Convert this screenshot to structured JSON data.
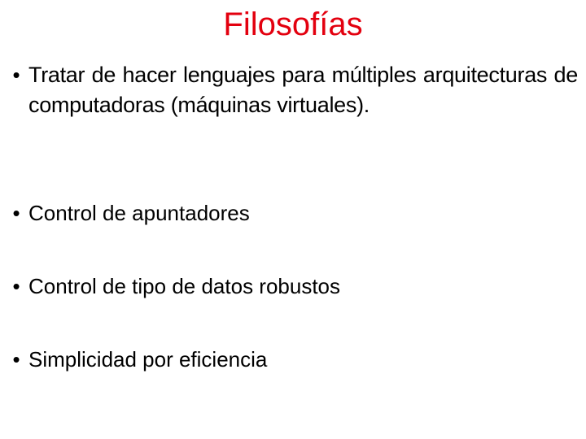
{
  "slide": {
    "title": "Filosofías",
    "title_color": "#e3000f",
    "bullet_glyph": "•",
    "bullets": [
      "Tratar de hacer lenguajes para múltiples arquitecturas de computadoras (máquinas virtuales).",
      "Control de apuntadores",
      "Control de tipo de datos robustos",
      "Simplicidad por eficiencia"
    ]
  }
}
